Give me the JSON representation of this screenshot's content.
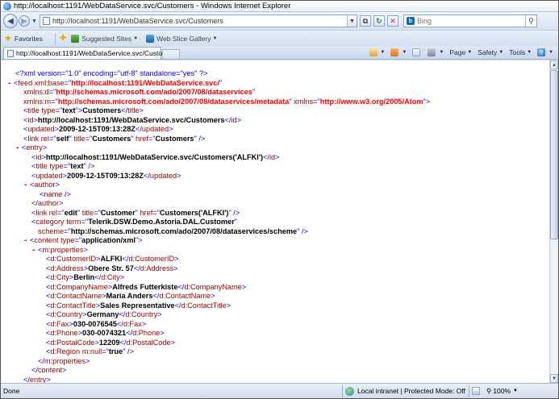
{
  "window": {
    "title": "http://localhost:1191/WebDataService.svc/Customers - Windows Internet Explorer"
  },
  "address": {
    "url": "http://localhost:1191/WebDataService.svc/Customers",
    "search_placeholder": "Bing"
  },
  "favorites": {
    "label": "Favorites",
    "links": [
      "Suggested Sites",
      "Web Slice Gallery"
    ]
  },
  "tab": {
    "label": "http://localhost:1191/WebDataService.svc/Customers"
  },
  "commands": {
    "page": "Page",
    "safety": "Safety",
    "tools": "Tools"
  },
  "xml": {
    "declaration": "<?xml version=\"1.0\" encoding=\"utf-8\" standalone=\"yes\" ?>",
    "feed_base": "http://localhost:1191/WebDataService.svc/",
    "xmlns_d": "http://schemas.microsoft.com/ado/2007/08/dataservices",
    "xmlns_m": "http://schemas.microsoft.com/ado/2007/08/dataservices/metadata",
    "xmlns": "http://www.w3.org/2005/Atom",
    "title": "Customers",
    "id": "http://localhost:1191/WebDataService.svc/Customers",
    "updated": "2009-12-15T09:13:28Z",
    "link_rel": "self",
    "link_title": "Customers",
    "link_href": "Customers",
    "entry": {
      "id": "http://localhost:1191/WebDataService.svc/Customers('ALFKI')",
      "updated": "2009-12-15T09:13:28Z",
      "link_rel": "edit",
      "link_title": "Customer",
      "link_href": "Customers('ALFKI')",
      "category_term": "Telerik.DSW.Demo.Astoria.DAL.Customer",
      "category_scheme": "http://schemas.microsoft.com/ado/2007/08/dataservices/scheme",
      "content_type": "application/xml",
      "properties": [
        {
          "name": "CustomerID",
          "value": "ALFKI"
        },
        {
          "name": "Address",
          "value": "Obere Str. 57"
        },
        {
          "name": "City",
          "value": "Berlin"
        },
        {
          "name": "CompanyName",
          "value": "Alfreds Futterkiste"
        },
        {
          "name": "ContactName",
          "value": "Maria Anders"
        },
        {
          "name": "ContactTitle",
          "value": "Sales Representative"
        },
        {
          "name": "Country",
          "value": "Germany"
        },
        {
          "name": "Fax",
          "value": "030-0076545"
        },
        {
          "name": "Phone",
          "value": "030-0074321"
        },
        {
          "name": "PostalCode",
          "value": "12209"
        }
      ],
      "region_null": "true"
    }
  },
  "status": {
    "text": "Done",
    "zone": "Local intranet | Protected Mode: Off",
    "zoom": "100%"
  }
}
